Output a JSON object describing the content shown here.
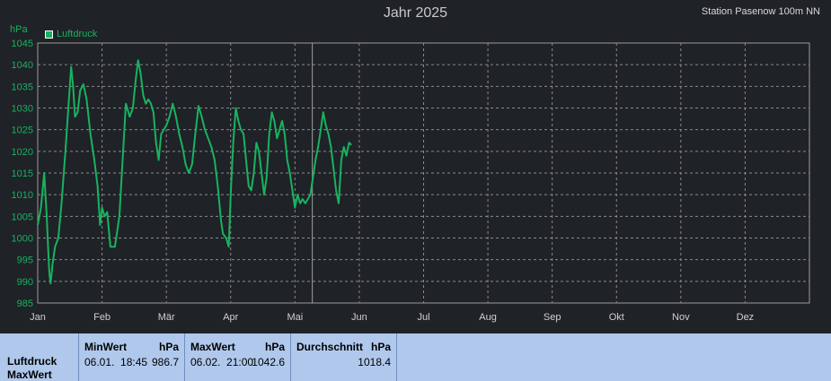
{
  "header": {
    "title": "Jahr 2025",
    "station": "Station Pasenow 100m NN"
  },
  "colors": {
    "background": "#1f2227",
    "series": "#17b35f",
    "grid": "#8a8a8a",
    "stats_bg": "#b0c8ec"
  },
  "chart_data": {
    "type": "line",
    "title": "Jahr 2025",
    "ylabel": "hPa",
    "ylim": [
      985,
      1045
    ],
    "yticks": [
      985,
      990,
      995,
      1000,
      1005,
      1010,
      1015,
      1020,
      1025,
      1030,
      1035,
      1040,
      1045
    ],
    "xlim": [
      0,
      12
    ],
    "month_labels": [
      "Jan",
      "Feb",
      "Mär",
      "Apr",
      "Mai",
      "Jun",
      "Jul",
      "Aug",
      "Sep",
      "Okt",
      "Nov",
      "Dez"
    ],
    "current_marker": 4.27,
    "grid": true,
    "legend_position": "top-left",
    "series": [
      {
        "name": "Luftdruck",
        "color": "#17b35f",
        "points": [
          [
            0.0,
            1003
          ],
          [
            0.05,
            1007
          ],
          [
            0.1,
            1015
          ],
          [
            0.14,
            1005
          ],
          [
            0.16,
            998
          ],
          [
            0.18,
            992
          ],
          [
            0.2,
            989.5
          ],
          [
            0.23,
            994
          ],
          [
            0.27,
            998
          ],
          [
            0.32,
            1000
          ],
          [
            0.37,
            1008
          ],
          [
            0.43,
            1020
          ],
          [
            0.48,
            1031
          ],
          [
            0.52,
            1039.5
          ],
          [
            0.55,
            1035
          ],
          [
            0.58,
            1028
          ],
          [
            0.62,
            1029
          ],
          [
            0.66,
            1034
          ],
          [
            0.71,
            1035.5
          ],
          [
            0.76,
            1032
          ],
          [
            0.82,
            1024
          ],
          [
            0.88,
            1018
          ],
          [
            0.93,
            1012
          ],
          [
            0.97,
            1003
          ],
          [
            1.0,
            1007
          ],
          [
            1.04,
            1005
          ],
          [
            1.08,
            1006
          ],
          [
            1.13,
            998
          ],
          [
            1.2,
            998
          ],
          [
            1.27,
            1005
          ],
          [
            1.32,
            1018
          ],
          [
            1.37,
            1031
          ],
          [
            1.43,
            1028
          ],
          [
            1.48,
            1030
          ],
          [
            1.52,
            1036
          ],
          [
            1.56,
            1041
          ],
          [
            1.6,
            1038
          ],
          [
            1.64,
            1033
          ],
          [
            1.68,
            1031
          ],
          [
            1.72,
            1032
          ],
          [
            1.76,
            1031
          ],
          [
            1.8,
            1029
          ],
          [
            1.84,
            1022
          ],
          [
            1.88,
            1018
          ],
          [
            1.92,
            1024
          ],
          [
            1.96,
            1025
          ],
          [
            2.0,
            1026
          ],
          [
            2.05,
            1028
          ],
          [
            2.1,
            1031
          ],
          [
            2.15,
            1028
          ],
          [
            2.2,
            1024
          ],
          [
            2.25,
            1021
          ],
          [
            2.3,
            1017
          ],
          [
            2.35,
            1015
          ],
          [
            2.4,
            1017
          ],
          [
            2.45,
            1024
          ],
          [
            2.5,
            1030.5
          ],
          [
            2.55,
            1028
          ],
          [
            2.6,
            1025
          ],
          [
            2.65,
            1023
          ],
          [
            2.7,
            1021
          ],
          [
            2.75,
            1018
          ],
          [
            2.8,
            1012
          ],
          [
            2.85,
            1004
          ],
          [
            2.88,
            1001
          ],
          [
            2.93,
            1000
          ],
          [
            2.97,
            998
          ],
          [
            3.0,
            1010
          ],
          [
            3.04,
            1022
          ],
          [
            3.08,
            1030
          ],
          [
            3.12,
            1027
          ],
          [
            3.16,
            1025
          ],
          [
            3.2,
            1024
          ],
          [
            3.24,
            1018
          ],
          [
            3.28,
            1012
          ],
          [
            3.32,
            1011
          ],
          [
            3.36,
            1015
          ],
          [
            3.4,
            1022
          ],
          [
            3.44,
            1020
          ],
          [
            3.48,
            1015
          ],
          [
            3.52,
            1010
          ],
          [
            3.56,
            1014
          ],
          [
            3.6,
            1024
          ],
          [
            3.64,
            1029
          ],
          [
            3.68,
            1027
          ],
          [
            3.72,
            1023
          ],
          [
            3.76,
            1025
          ],
          [
            3.8,
            1027
          ],
          [
            3.84,
            1024
          ],
          [
            3.88,
            1018
          ],
          [
            3.92,
            1015
          ],
          [
            3.96,
            1011
          ],
          [
            4.0,
            1007
          ],
          [
            4.04,
            1010
          ],
          [
            4.08,
            1008
          ],
          [
            4.12,
            1009
          ],
          [
            4.16,
            1008
          ],
          [
            4.2,
            1009
          ],
          [
            4.24,
            1010
          ],
          [
            4.28,
            1014
          ],
          [
            4.32,
            1018
          ],
          [
            4.36,
            1021
          ],
          [
            4.4,
            1025
          ],
          [
            4.44,
            1029
          ],
          [
            4.48,
            1026
          ],
          [
            4.52,
            1024
          ],
          [
            4.56,
            1021
          ],
          [
            4.6,
            1016
          ],
          [
            4.64,
            1011
          ],
          [
            4.68,
            1008
          ],
          [
            4.72,
            1018
          ],
          [
            4.76,
            1021
          ],
          [
            4.8,
            1019
          ],
          [
            4.84,
            1022
          ],
          [
            4.88,
            1021.5
          ]
        ]
      }
    ]
  },
  "stats": {
    "row_label_1": "Luftdruck",
    "row_label_2": "MaxWert",
    "min": {
      "label": "MinWert",
      "unit": "hPa",
      "date": "06.01.  18:45",
      "value": "986.7"
    },
    "max": {
      "label": "MaxWert",
      "unit": "hPa",
      "date": "06.02.  21:00",
      "value": "1042.6"
    },
    "avg": {
      "label": "Durchschnitt",
      "unit": "hPa",
      "value": "1018.4"
    }
  }
}
